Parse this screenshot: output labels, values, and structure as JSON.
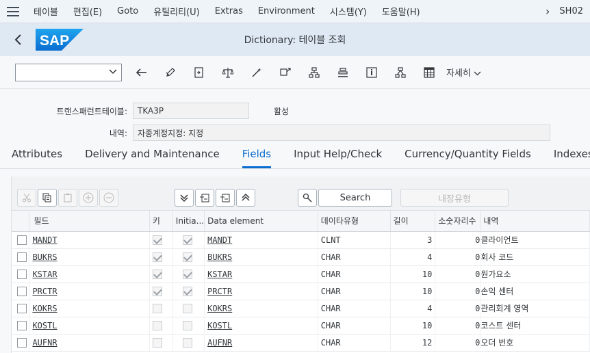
{
  "menu": {
    "items": [
      "테이블",
      "편집(E)",
      "Goto",
      "유틸리티(U)",
      "Extras",
      "Environment",
      "시스템(Y)",
      "도움말(H)"
    ],
    "tcode": "SH02"
  },
  "header": {
    "title": "Dictionary: 테이블 조회",
    "logo_text": "SAP"
  },
  "toolbar": {
    "command_value": "",
    "more_label": "자세히"
  },
  "form": {
    "table_label": "트랜스패런트테이블:",
    "table_value": "TKA3P",
    "status_value": "활성",
    "desc_label": "내역:",
    "desc_value": "자종계정지정: 지정"
  },
  "tabs": [
    "Attributes",
    "Delivery and Maintenance",
    "Fields",
    "Input Help/Check",
    "Currency/Quantity Fields",
    "Indexes"
  ],
  "active_tab": "Fields",
  "grid": {
    "search_label": "Search",
    "builtin_type_label": "내장유형",
    "columns": [
      "필드",
      "키",
      "Initia...",
      "Data element",
      "데이타유형",
      "길이",
      "소숫자리수",
      "내역"
    ],
    "rows": [
      {
        "field": "MANDT",
        "key": true,
        "initial": true,
        "element": "MANDT",
        "type": "CLNT",
        "length": "3",
        "decimals": "0",
        "desc": "클라이언트"
      },
      {
        "field": "BUKRS",
        "key": true,
        "initial": true,
        "element": "BUKRS",
        "type": "CHAR",
        "length": "4",
        "decimals": "0",
        "desc": "회사 코드"
      },
      {
        "field": "KSTAR",
        "key": true,
        "initial": true,
        "element": "KSTAR",
        "type": "CHAR",
        "length": "10",
        "decimals": "0",
        "desc": "원가요소"
      },
      {
        "field": "PRCTR",
        "key": true,
        "initial": true,
        "element": "PRCTR",
        "type": "CHAR",
        "length": "10",
        "decimals": "0",
        "desc": "손익 센터"
      },
      {
        "field": "KOKRS",
        "key": false,
        "initial": false,
        "element": "KOKRS",
        "type": "CHAR",
        "length": "4",
        "decimals": "0",
        "desc": "관리회계 영역"
      },
      {
        "field": "KOSTL",
        "key": false,
        "initial": false,
        "element": "KOSTL",
        "type": "CHAR",
        "length": "10",
        "decimals": "0",
        "desc": "코스트 센터"
      },
      {
        "field": "AUFNR",
        "key": false,
        "initial": false,
        "element": "AUFNR",
        "type": "CHAR",
        "length": "12",
        "decimals": "0",
        "desc": "오더 번호"
      }
    ]
  },
  "colors": {
    "accent": "#0a6ed1",
    "titlebar_bg": "#dfe9f4",
    "menubar_bg": "#eff4f9"
  },
  "icons": [
    "menu-icon",
    "chevron-right-icon",
    "back-arrow-icon",
    "arrow-left-icon",
    "edit-icon",
    "display-change-icon",
    "compare-icon",
    "magic-wand-icon",
    "object-list-icon",
    "hierarchy-icon",
    "stack-icon",
    "info-icon",
    "graph-icon",
    "table-icon",
    "chevron-down-icon",
    "cut-icon",
    "copy-icon",
    "paste-icon",
    "insert-row-icon",
    "delete-row-icon",
    "collapse-icon",
    "expand-icon",
    "search-icon"
  ]
}
